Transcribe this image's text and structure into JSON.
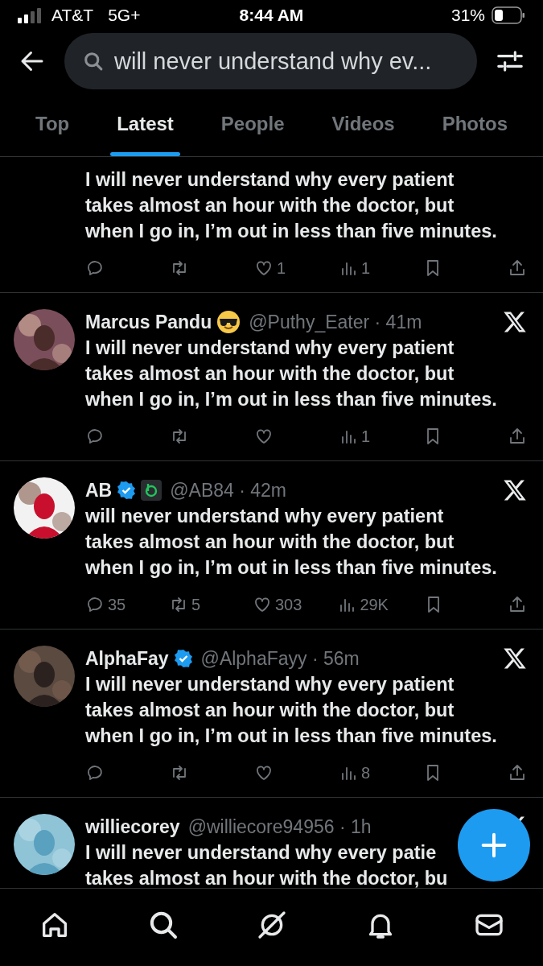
{
  "status_bar": {
    "carrier": "AT&T",
    "network": "5G+",
    "time": "8:44 AM",
    "battery": "31%"
  },
  "search": {
    "value": "will never understand why ev..."
  },
  "tabs": [
    {
      "label": "Top",
      "selected": false
    },
    {
      "label": "Latest",
      "selected": true
    },
    {
      "label": "People",
      "selected": false
    },
    {
      "label": "Videos",
      "selected": false
    },
    {
      "label": "Photos",
      "selected": false
    }
  ],
  "tweets": [
    {
      "lines": [
        "I will never understand why every patient",
        "takes almost an hour with the doctor, but",
        "when I go in, I’m out in less than five minutes."
      ],
      "actions": {
        "like": "1",
        "views": "1"
      }
    },
    {
      "avatar": {
        "kind": "picture"
      },
      "name": "Marcus Pandu",
      "badges": [
        {
          "kind": "emoji"
        }
      ],
      "meta": "@Puthy_Eater · 41m",
      "lines": [
        "I will never understand why every patient",
        "takes almost an hour with the doctor, but",
        "when I go in, I’m out in less than five minutes."
      ],
      "actions": {
        "views": "1"
      }
    },
    {
      "avatar": {
        "kind": "picture"
      },
      "name": "AB",
      "badges": [
        {
          "kind": "verified"
        },
        {
          "kind": "affiliate"
        }
      ],
      "meta": "@AB84 · 42m",
      "lines": [
        "will never understand why every patient",
        "takes almost an hour with the doctor, but",
        "when I go in, I’m out in less than five minutes."
      ],
      "actions": {
        "reply": "35",
        "repost": "5",
        "like": "303",
        "views": "29K"
      }
    },
    {
      "avatar": {
        "kind": "picture"
      },
      "name": "AlphaFay",
      "badges": [
        {
          "kind": "verified"
        }
      ],
      "meta": "@AlphaFayy · 56m",
      "lines": [
        "I will never understand why every patient",
        "takes almost an hour with the doctor, but",
        "when I go in, I’m out in less than five minutes."
      ],
      "actions": {
        "views": "8"
      }
    },
    {
      "avatar": {
        "kind": "picture"
      },
      "name": "williecorey",
      "meta": "@williecore94956 · 1h",
      "lines": [
        "I will never understand why every patie",
        "takes almost an hour with the doctor, bu"
      ]
    }
  ]
}
